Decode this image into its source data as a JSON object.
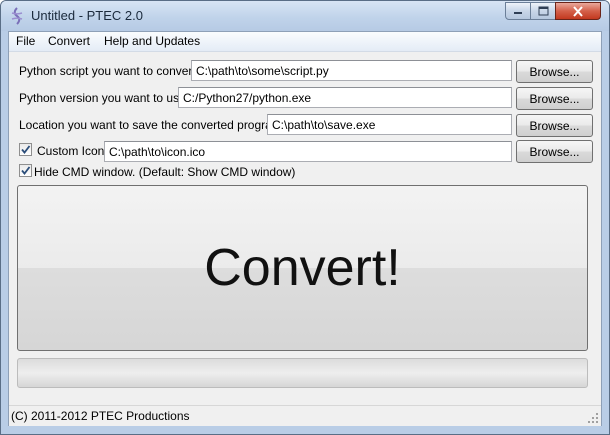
{
  "window": {
    "title": "Untitled - PTEC 2.0"
  },
  "menu": {
    "file": "File",
    "convert": "Convert",
    "help": "Help and Updates"
  },
  "rows": {
    "script": {
      "label": "Python script you want to convert:",
      "value": "C:\\path\\to\\some\\script.py",
      "browse": "Browse..."
    },
    "version": {
      "label": "Python version you want to use:",
      "value": "C:/Python27/python.exe",
      "browse": "Browse..."
    },
    "location": {
      "label": "Location you want to save the converted program:",
      "value": "C:\\path\\to\\save.exe",
      "browse": "Browse..."
    },
    "icon": {
      "label": "Custom Icon:",
      "checked": true,
      "value": "C:\\path\\to\\icon.ico",
      "browse": "Browse..."
    }
  },
  "hide_cmd": {
    "label": "Hide CMD window. (Default: Show CMD window)",
    "checked": true
  },
  "convert_button": "Convert!",
  "progress": {
    "fraction": 0
  },
  "status": "(C) 2011-2012 PTEC Productions",
  "colors": {
    "progress_fill": "#38b334",
    "title_bar": "#c5d6ea",
    "close_button": "#c2391f"
  }
}
